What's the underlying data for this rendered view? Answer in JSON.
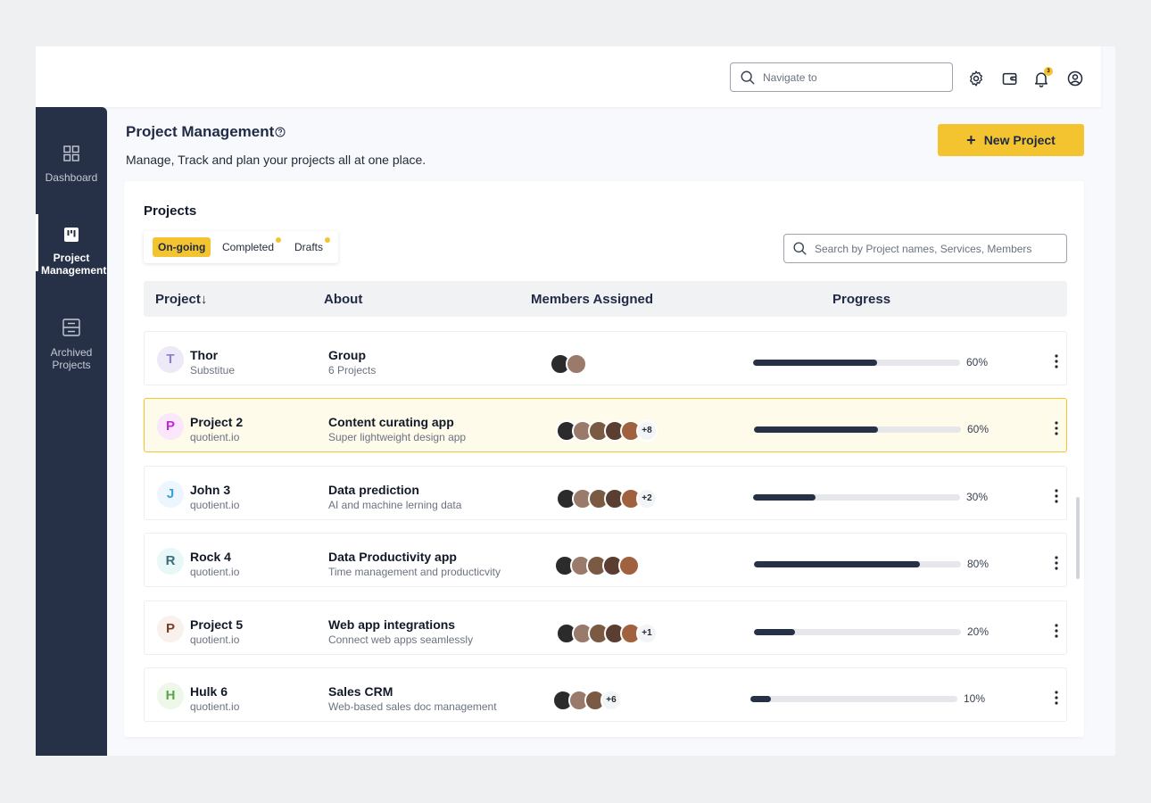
{
  "header": {
    "search_placeholder": "Navigate to",
    "notification_count": "3"
  },
  "sidebar": {
    "items": [
      {
        "label": "Dashboard",
        "icon": "grid-icon"
      },
      {
        "label": "Project Management",
        "icon": "kanban-icon",
        "active": true
      },
      {
        "label": "Archived Projects",
        "icon": "archive-icon"
      }
    ]
  },
  "page": {
    "title": "Project Management",
    "subtitle": "Manage, Track and plan your projects all at one place.",
    "new_button_label": "New Project"
  },
  "projects": {
    "title": "Projects",
    "tabs": [
      {
        "label": "On-going",
        "active": true,
        "dot": false
      },
      {
        "label": "Completed",
        "active": false,
        "dot": true
      },
      {
        "label": "Drafts",
        "active": false,
        "dot": true
      }
    ],
    "search_placeholder": "Search by Project names, Services, Members",
    "columns": [
      "Project↓",
      "About",
      "Members Assigned",
      "Progress"
    ],
    "rows": [
      {
        "initial": "T",
        "name": "Thor",
        "sub": "Substitue",
        "about_title": "Group",
        "about_sub": "6 Projects",
        "avatars": 2,
        "more": "",
        "progress": 60,
        "progress_label": "60%",
        "badge_bg": "#ede9f7",
        "badge_color": "#8b7fc7",
        "highlight": false
      },
      {
        "initial": "P",
        "name": "Project 2",
        "sub": "quotient.io",
        "about_title": "Content curating app",
        "about_sub": "Super lightweight design app",
        "avatars": 5,
        "more": "+8",
        "progress": 60,
        "progress_label": "60%",
        "badge_bg": "#fbe7fb",
        "badge_color": "#c026d3",
        "highlight": true
      },
      {
        "initial": "J",
        "name": "John 3",
        "sub": "quotient.io",
        "about_title": "Data prediction",
        "about_sub": "AI and machine lerning data",
        "avatars": 5,
        "more": "+2",
        "progress": 30,
        "progress_label": "30%",
        "badge_bg": "#eef6fd",
        "badge_color": "#38a0e0",
        "highlight": false
      },
      {
        "initial": "R",
        "name": "Rock 4",
        "sub": "quotient.io",
        "about_title": "Data Productivity app",
        "about_sub": "Time management and producticvity",
        "avatars": 5,
        "more": "",
        "progress": 80,
        "progress_label": "80%",
        "badge_bg": "#e8f7f7",
        "badge_color": "#3a6d7a",
        "highlight": false
      },
      {
        "initial": "P",
        "name": "Project 5",
        "sub": "quotient.io",
        "about_title": "Web app integrations",
        "about_sub": "Connect web apps seamlessly",
        "avatars": 5,
        "more": "+1",
        "progress": 20,
        "progress_label": "20%",
        "badge_bg": "#f9f1ec",
        "badge_color": "#7a3f22",
        "highlight": false
      },
      {
        "initial": "H",
        "name": "Hulk 6",
        "sub": "quotient.io",
        "about_title": "Sales CRM",
        "about_sub": "Web-based sales doc management",
        "avatars": 3,
        "more": "+6",
        "progress": 10,
        "progress_label": "10%",
        "badge_bg": "#eef8e8",
        "badge_color": "#5aa64a",
        "highlight": false
      }
    ]
  },
  "colors": {
    "accent": "#f4c430",
    "sidebar": "#263046",
    "progress_fill": "#263046"
  }
}
